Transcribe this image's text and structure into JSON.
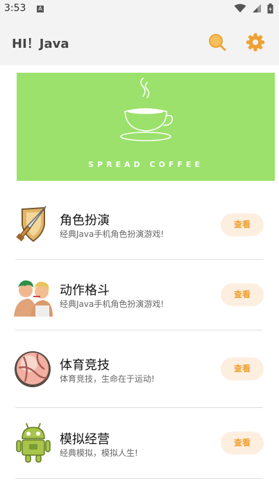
{
  "status": {
    "time": "3:53",
    "notify_badge": "A"
  },
  "appbar": {
    "title": "HI！Java",
    "search_icon": "search-icon",
    "settings_icon": "gear-icon",
    "accent": "#f0a133"
  },
  "banner": {
    "text": "SPREAD COFFEE",
    "bg": "#9be16b"
  },
  "list": {
    "button_label": "查看",
    "items": [
      {
        "title": "角色扮演",
        "desc": "经典Java手机角色扮演游戏!",
        "icon": "sword-shield-icon"
      },
      {
        "title": "动作格斗",
        "desc": "经典Java手机角色扮演游戏!",
        "icon": "fighters-icon"
      },
      {
        "title": "体育竞技",
        "desc": "体育竞技，生命在于运动!",
        "icon": "ball-icon"
      },
      {
        "title": "模拟经营",
        "desc": "经典模拟，模拟人生!",
        "icon": "android-robot-icon"
      }
    ]
  }
}
